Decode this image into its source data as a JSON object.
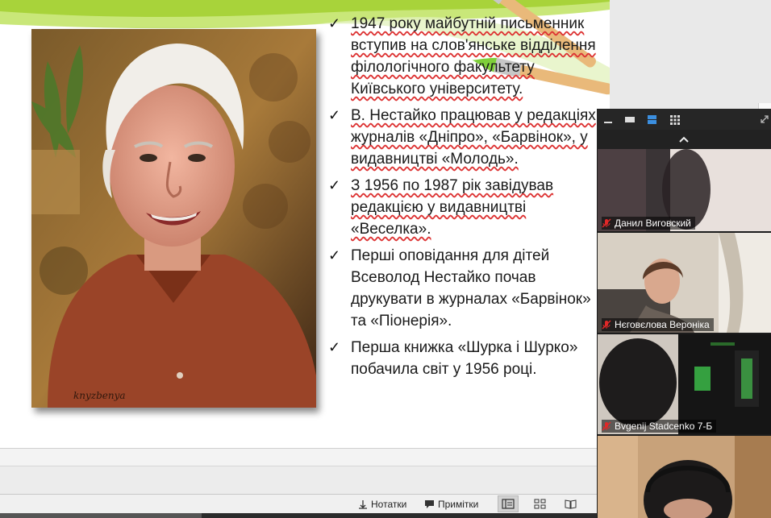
{
  "slide": {
    "bullets": [
      "1947 року майбутній письменник вступив на слов'янське відділення філологічного факультету Київського університету.",
      "В. Нестайко працював у редакціях журналів «Дніпро», «Барвінок», у видавництві «Молодь».",
      "З 1956 по 1987 рік завідував редакцією у видавництві «Веселка».",
      "Перші оповідання для дітей Всеволод Нестайко почав друкувати в журналах «Барвінок» та «Піонерія».",
      "Перша книжка «Шурка і Шурко» побачила світ у 1956 році."
    ],
    "photo_signature": "knyzbenya",
    "accent_color": "#9ccc2a"
  },
  "statusbar": {
    "notes_label": "Нотатки",
    "comments_label": "Примітки",
    "views": [
      "normal-view",
      "slide-sorter-view",
      "reading-view"
    ],
    "active_view": "normal-view"
  },
  "zoom": {
    "participants": [
      {
        "name": "Данил Виговский",
        "muted": true
      },
      {
        "name": "Нєговєлова Вероніка",
        "muted": true
      },
      {
        "name": "Bvgenij Stadcenko 7-Б",
        "muted": true
      },
      {
        "name": "",
        "muted": false
      }
    ],
    "mute_color": "#e02828"
  }
}
